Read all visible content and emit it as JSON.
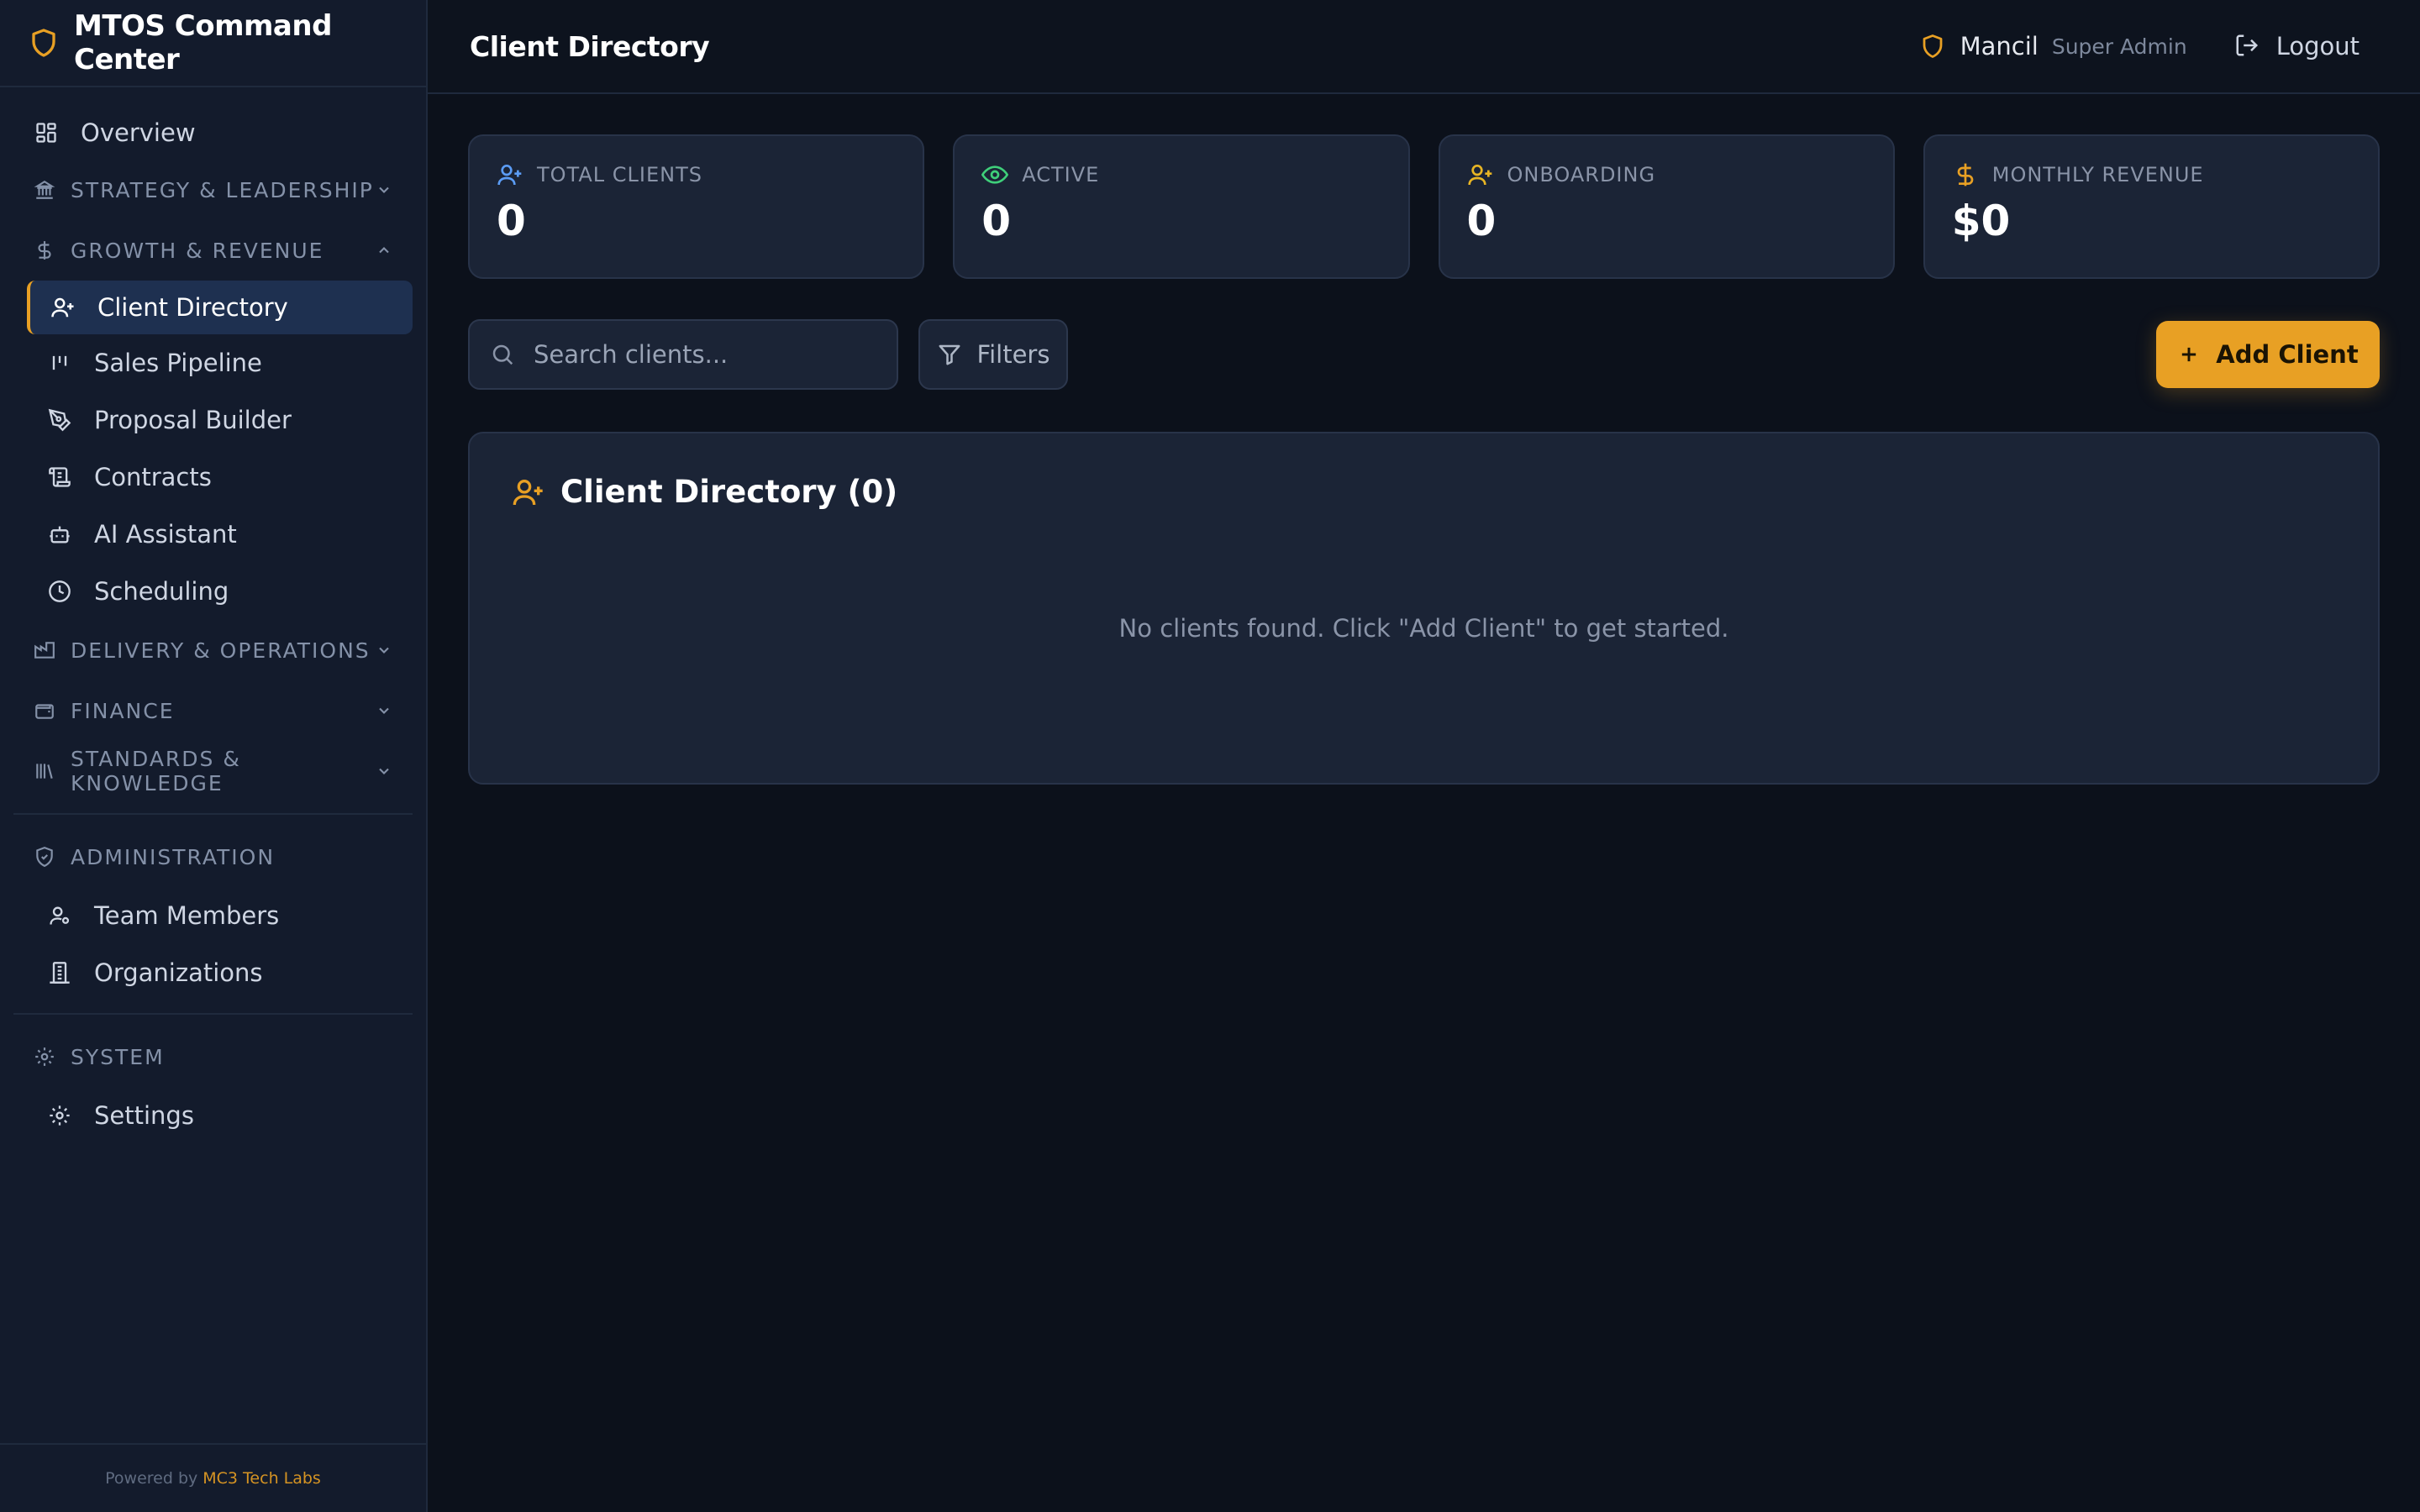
{
  "brand": {
    "title": "MTOS Command Center"
  },
  "sidebar": {
    "overview": "Overview",
    "sections": {
      "strategy": "STRATEGY & LEADERSHIP",
      "growth": "GROWTH & REVENUE",
      "delivery": "DELIVERY & OPERATIONS",
      "finance": "FINANCE",
      "standards": "STANDARDS & KNOWLEDGE",
      "administration": "ADMINISTRATION",
      "system": "SYSTEM"
    },
    "growth_items": [
      "Client Directory",
      "Sales Pipeline",
      "Proposal Builder",
      "Contracts",
      "AI Assistant",
      "Scheduling"
    ],
    "admin_items": [
      "Team Members",
      "Organizations"
    ],
    "system_items": [
      "Settings"
    ],
    "active_item": "Client Directory"
  },
  "footer": {
    "prefix": "Powered by",
    "company": "MC3 Tech Labs"
  },
  "header": {
    "title": "Client Directory",
    "user_name": "Mancil",
    "user_role": "Super Admin",
    "logout": "Logout"
  },
  "stats": [
    {
      "label": "TOTAL CLIENTS",
      "value": "0",
      "icon": "user-plus-icon",
      "color": "#5b9cf5"
    },
    {
      "label": "ACTIVE",
      "value": "0",
      "icon": "eye-icon",
      "color": "#3fcf7a"
    },
    {
      "label": "ONBOARDING",
      "value": "0",
      "icon": "user-plus-icon",
      "color": "#e8b524"
    },
    {
      "label": "MONTHLY REVENUE",
      "value": "$0",
      "icon": "dollar-icon",
      "color": "#e8a024"
    }
  ],
  "toolbar": {
    "search_placeholder": "Search clients...",
    "filters_label": "Filters",
    "add_label": "Add Client"
  },
  "panel": {
    "title": "Client Directory (0)",
    "empty_message": "No clients found. Click \"Add Client\" to get started."
  },
  "colors": {
    "accent": "#e8a024",
    "sidebar_bg": "#131b2c",
    "page_bg": "#0c111b",
    "card_bg": "#1b2436"
  }
}
